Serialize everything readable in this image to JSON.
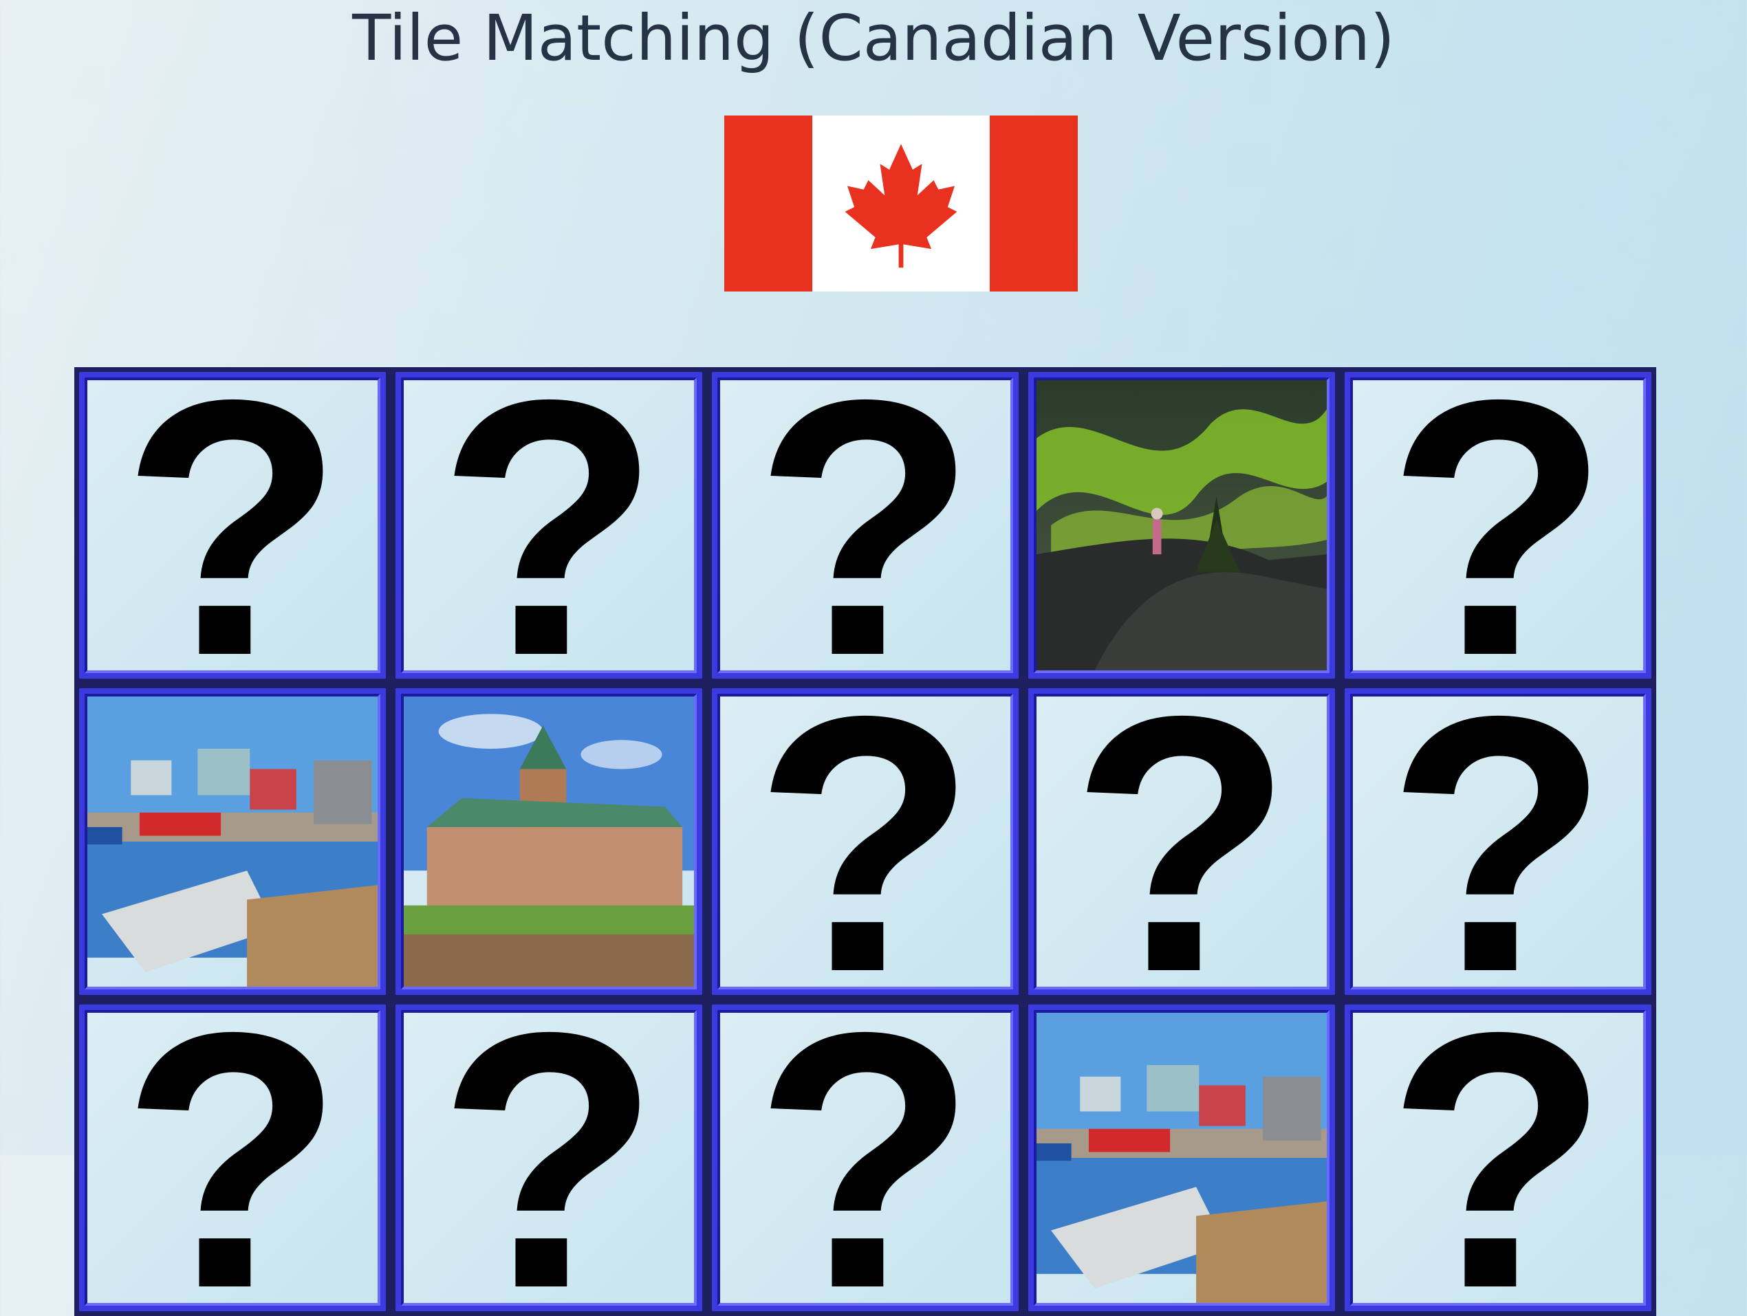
{
  "header": {
    "title": "Tile Matching (Canadian Version)"
  },
  "flag": {
    "emblem": "maple-leaf-icon",
    "red": "#e8321f",
    "white": "#ffffff"
  },
  "colors": {
    "tile_frame": "#3a3ae0",
    "tile_outline": "#1d1f5e",
    "hidden_face": "#d2e9f2",
    "question_mark": "#000000"
  },
  "board": {
    "columns": 5,
    "tiles": [
      {
        "state": "hidden",
        "face": "?"
      },
      {
        "state": "hidden",
        "face": "?"
      },
      {
        "state": "hidden",
        "face": "?"
      },
      {
        "state": "revealed",
        "image": "northern-lights-photo"
      },
      {
        "state": "hidden",
        "face": "?"
      },
      {
        "state": "revealed",
        "image": "fishing-village-photo"
      },
      {
        "state": "revealed",
        "image": "chateau-frontenac-photo"
      },
      {
        "state": "hidden",
        "face": "?"
      },
      {
        "state": "hidden",
        "face": "?"
      },
      {
        "state": "hidden",
        "face": "?"
      },
      {
        "state": "hidden",
        "face": "?"
      },
      {
        "state": "hidden",
        "face": "?"
      },
      {
        "state": "hidden",
        "face": "?"
      },
      {
        "state": "revealed",
        "image": "fishing-village-photo"
      },
      {
        "state": "hidden",
        "face": "?"
      }
    ]
  }
}
